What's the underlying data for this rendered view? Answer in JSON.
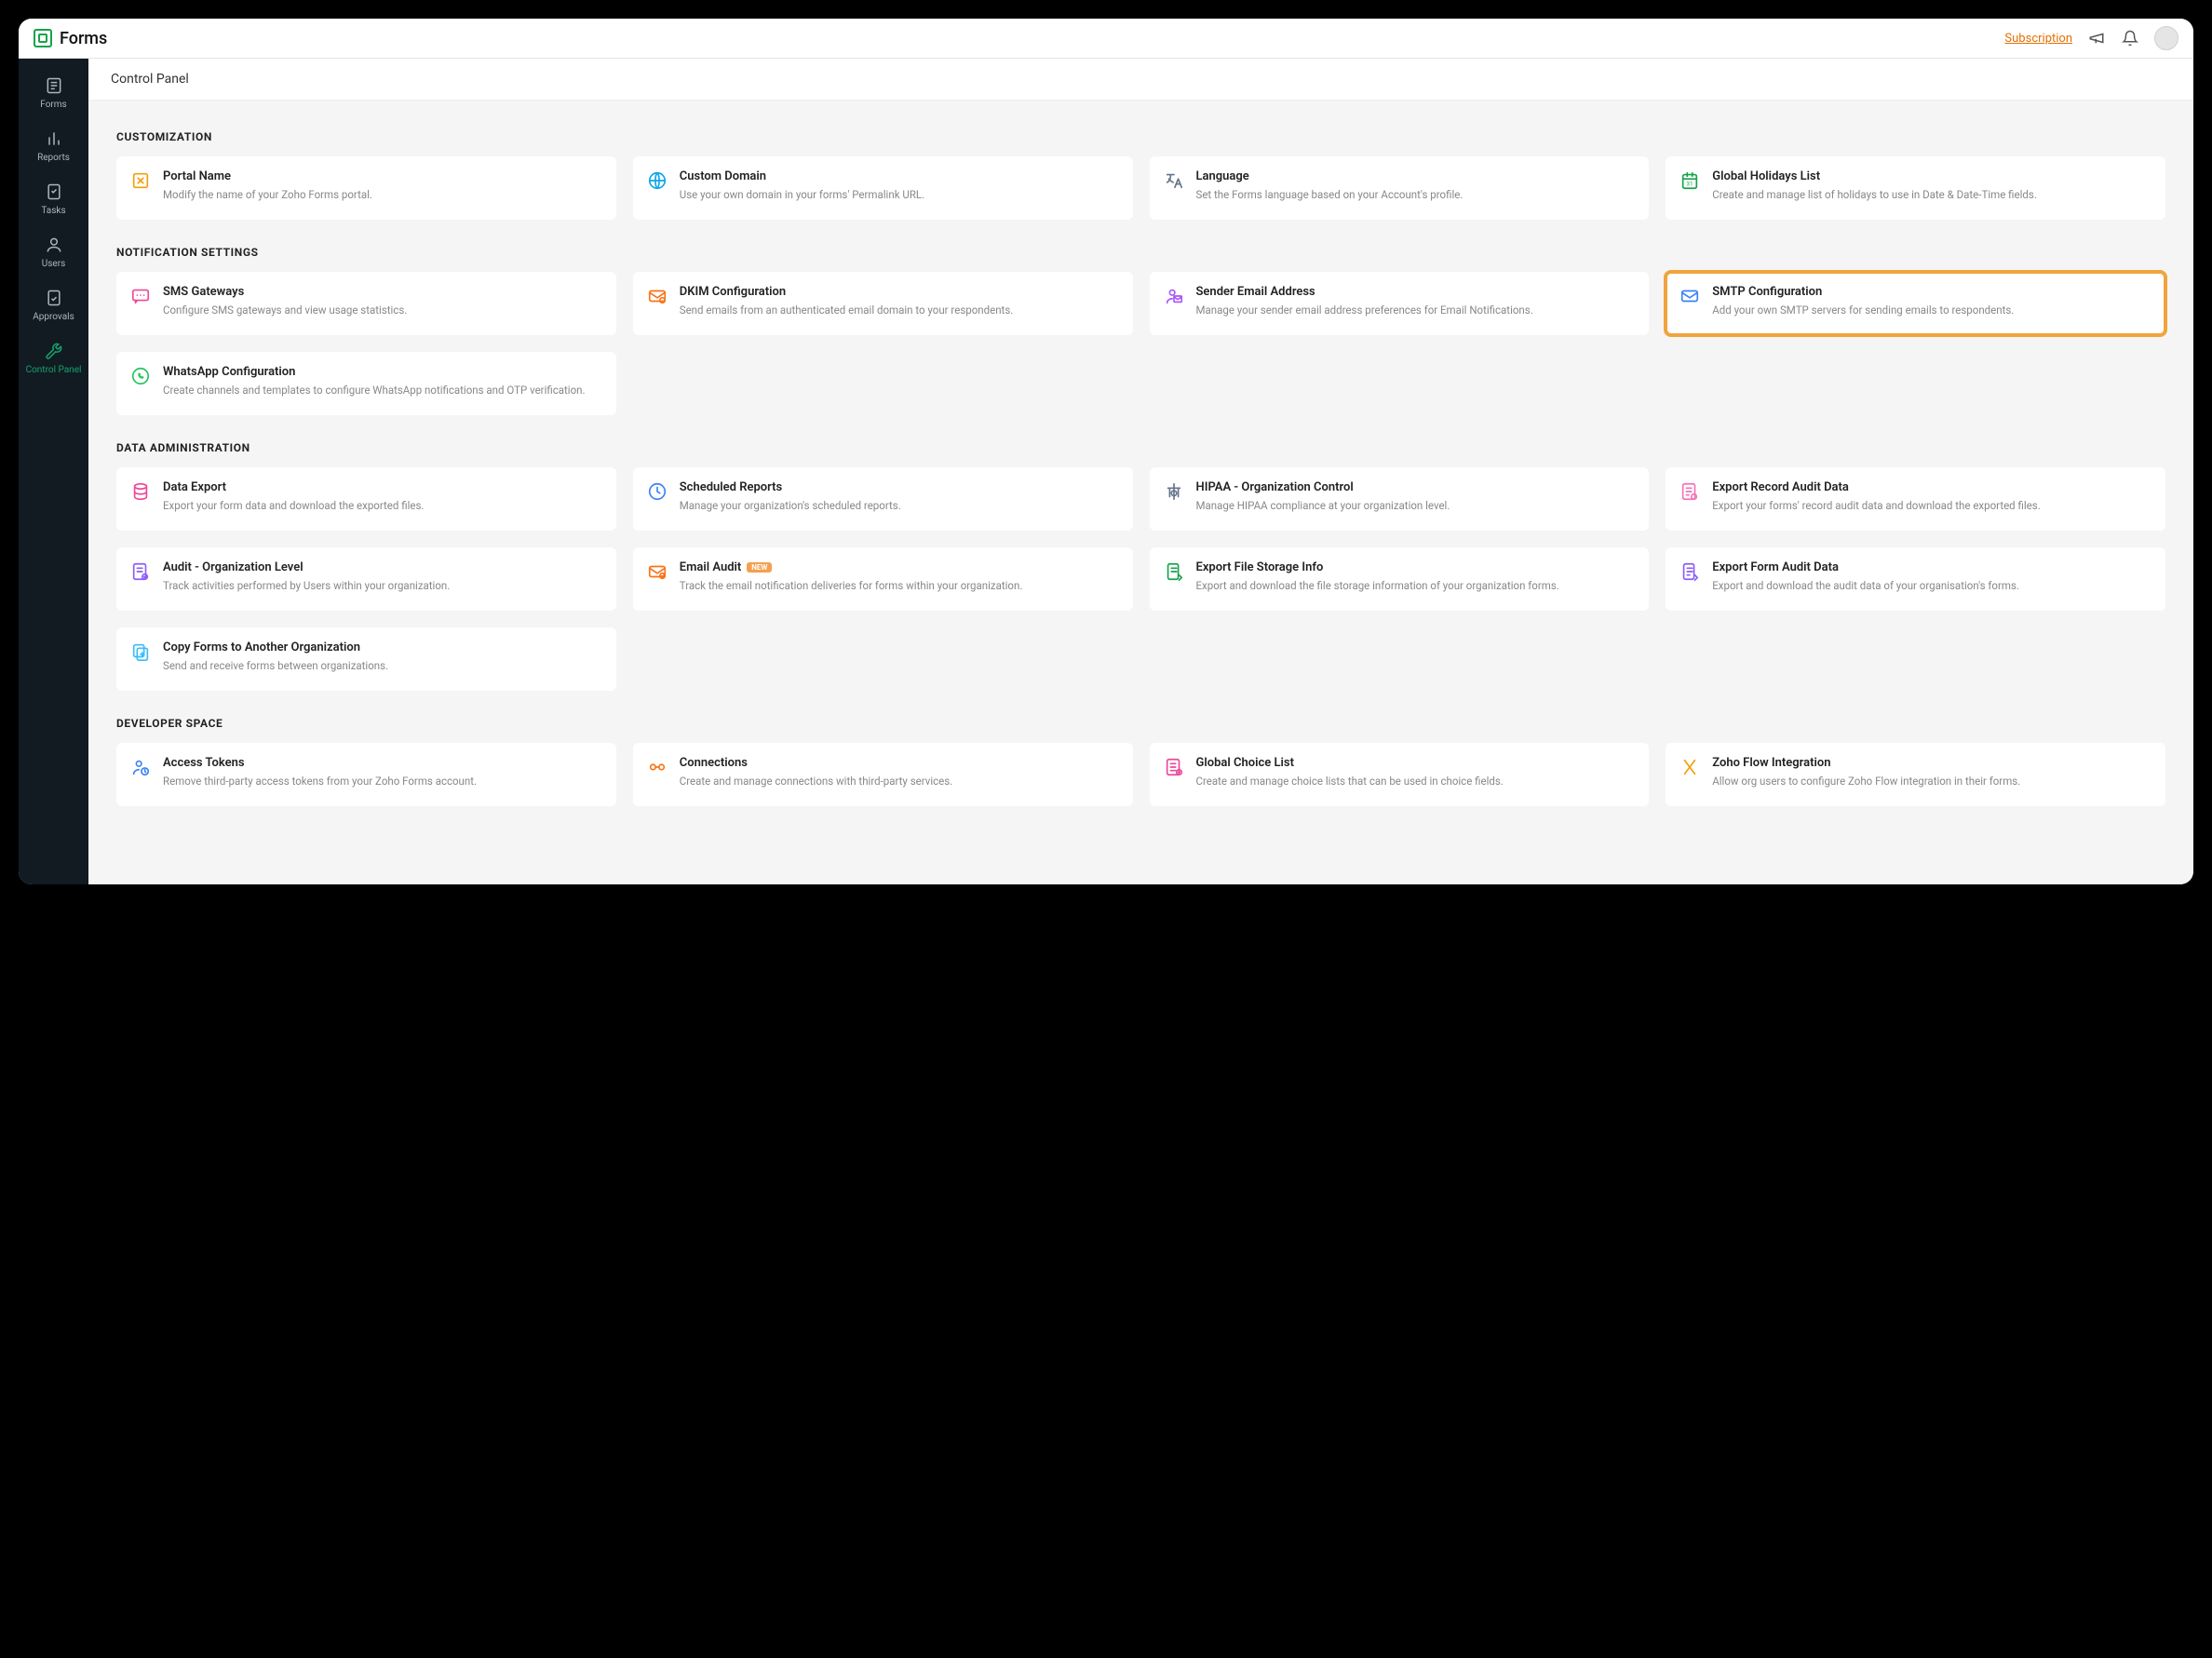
{
  "app_name": "Forms",
  "top": {
    "subscription": "Subscription"
  },
  "sidebar": [
    {
      "label": "Forms"
    },
    {
      "label": "Reports"
    },
    {
      "label": "Tasks"
    },
    {
      "label": "Users"
    },
    {
      "label": "Approvals"
    },
    {
      "label": "Control Panel"
    }
  ],
  "page_title": "Control Panel",
  "sections": [
    {
      "title": "CUSTOMIZATION",
      "cards": [
        {
          "title": "Portal Name",
          "desc": "Modify the name of your Zoho Forms portal.",
          "icon": "portal",
          "color": "#f59e0b"
        },
        {
          "title": "Custom Domain",
          "desc": "Use your own domain in your forms' Permalink URL.",
          "icon": "domain",
          "color": "#0ea5e9"
        },
        {
          "title": "Language",
          "desc": "Set the Forms language based on your Account's profile.",
          "icon": "language",
          "color": "#64748b"
        },
        {
          "title": "Global Holidays List",
          "desc": "Create and manage list of holidays to use in Date & Date-Time fields.",
          "icon": "calendar",
          "color": "#16a34a"
        }
      ]
    },
    {
      "title": "NOTIFICATION SETTINGS",
      "cards": [
        {
          "title": "SMS Gateways",
          "desc": "Configure SMS gateways and view usage statistics.",
          "icon": "sms",
          "color": "#ec4899"
        },
        {
          "title": "DKIM Configuration",
          "desc": "Send emails from an authenticated email domain to your respondents.",
          "icon": "dkim",
          "color": "#f97316"
        },
        {
          "title": "Sender Email Address",
          "desc": "Manage your sender email address preferences for Email Notifications.",
          "icon": "sender",
          "color": "#a855f7"
        },
        {
          "title": "SMTP Configuration",
          "desc": "Add your own SMTP servers for sending emails to respondents.",
          "icon": "smtp",
          "color": "#3b82f6",
          "highlight": true
        },
        {
          "title": "WhatsApp Configuration",
          "desc": "Create channels and templates to configure WhatsApp notifications and OTP verification.",
          "icon": "whatsapp",
          "color": "#22c55e"
        }
      ]
    },
    {
      "title": "DATA ADMINISTRATION",
      "cards": [
        {
          "title": "Data Export",
          "desc": "Export your form data and download the exported files.",
          "icon": "export",
          "color": "#ec4899"
        },
        {
          "title": "Scheduled Reports",
          "desc": "Manage your organization's scheduled reports.",
          "icon": "clock",
          "color": "#3b82f6"
        },
        {
          "title": "HIPAA - Organization Control",
          "desc": "Manage HIPAA compliance at your organization level.",
          "icon": "hipaa",
          "color": "#64748b"
        },
        {
          "title": "Export Record Audit Data",
          "desc": "Export your forms' record audit data and download the exported files.",
          "icon": "audit",
          "color": "#f472b6"
        },
        {
          "title": "Audit - Organization Level",
          "desc": "Track activities performed by Users within your organization.",
          "icon": "orgaudit",
          "color": "#8b5cf6"
        },
        {
          "title": "Email Audit",
          "desc": "Track the email notification deliveries for forms within your organization.",
          "icon": "emailaudit",
          "color": "#f97316",
          "badge": "NEW"
        },
        {
          "title": "Export File Storage Info",
          "desc": "Export and download the file storage information of your organization forms.",
          "icon": "storage",
          "color": "#16a34a"
        },
        {
          "title": "Export Form Audit Data",
          "desc": "Export and download the audit data of your organisation's forms.",
          "icon": "formaudit",
          "color": "#8b5cf6"
        },
        {
          "title": "Copy Forms to Another Organization",
          "desc": "Send and receive forms between organizations.",
          "icon": "copy",
          "color": "#38bdf8"
        }
      ]
    },
    {
      "title": "DEVELOPER SPACE",
      "cards": [
        {
          "title": "Access Tokens",
          "desc": "Remove third-party access tokens from your Zoho Forms account.",
          "icon": "token",
          "color": "#3b82f6"
        },
        {
          "title": "Connections",
          "desc": "Create and manage connections with third-party services.",
          "icon": "connect",
          "color": "#f97316"
        },
        {
          "title": "Global Choice List",
          "desc": "Create and manage choice lists that can be used in choice fields.",
          "icon": "choice",
          "color": "#ec4899"
        },
        {
          "title": "Zoho Flow Integration",
          "desc": "Allow org users to configure Zoho Flow integration in their forms.",
          "icon": "flow",
          "color": "#f59e0b"
        }
      ]
    }
  ]
}
